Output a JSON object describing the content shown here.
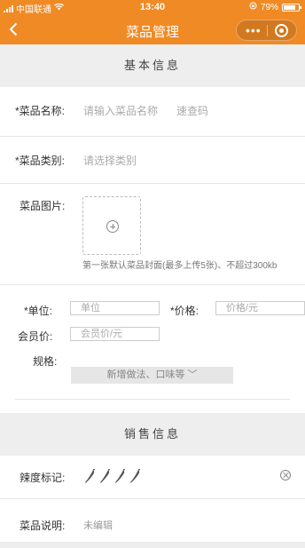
{
  "status": {
    "carrier": "中国联通",
    "time": "13:40",
    "battery": "79%"
  },
  "nav": {
    "back_icon": "chevron-left-icon",
    "title": "菜品管理",
    "more_icon": "more-dots-icon",
    "close_icon": "target-circle-icon"
  },
  "basic": {
    "section_title": "基本信息",
    "name_label": "*菜品名称:",
    "name_placeholder": "请输入菜品名称",
    "quick_code_placeholder": "速查码",
    "category_label": "*菜品类别:",
    "category_placeholder": "请选择类别",
    "image_label": "菜品图片:",
    "image_hint": "第一张默认菜品封面(最多上传5张)、不超过300kb",
    "unit_label": "*单位:",
    "unit_placeholder": "单位",
    "price_label": "*价格:",
    "price_placeholder": "价格/元",
    "member_price_label": "会员价:",
    "member_price_placeholder": "会员价/元",
    "spec_label": "规格:",
    "spec_button": "新增做法、口味等 ﹀"
  },
  "sales": {
    "section_title": "销售信息",
    "spicy_label": "辣度标记:",
    "spicy_level": 0,
    "spicy_max": 4,
    "desc_label": "菜品说明:",
    "desc_value": "未编辑"
  },
  "colors": {
    "brand": "#f08a24",
    "section_bg": "#eeeeee"
  }
}
